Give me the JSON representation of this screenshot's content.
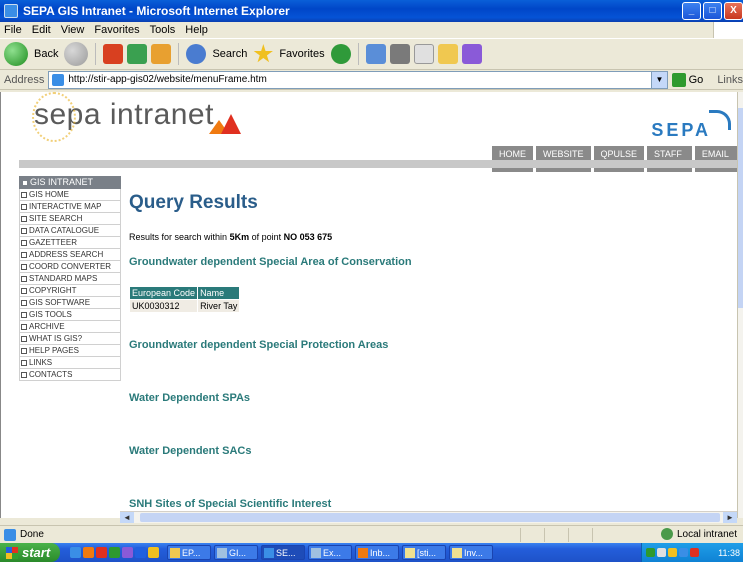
{
  "window": {
    "title": "SEPA GIS Intranet - Microsoft Internet Explorer",
    "controls": [
      "_",
      "□",
      "X"
    ]
  },
  "menubar": [
    "File",
    "Edit",
    "View",
    "Favorites",
    "Tools",
    "Help"
  ],
  "toolbar": {
    "back_label": "Back",
    "search_label": "Search",
    "favorites_label": "Favorites"
  },
  "address": {
    "label": "Address",
    "url": "http://stir-app-gis02/website/menuFrame.htm",
    "go_label": "Go",
    "links_label": "Links"
  },
  "site": {
    "logo_text": "sepa intranet",
    "brand": "SEPA",
    "top_nav": [
      "HOME",
      "WEBSITE",
      "QPULSE",
      "STAFF DIR",
      "EMAIL US"
    ]
  },
  "sidemenu": {
    "header": "GIS INTRANET",
    "items": [
      "GIS HOME",
      "INTERACTIVE MAP",
      "SITE SEARCH",
      "DATA CATALOGUE",
      "GAZETTEER",
      "ADDRESS SEARCH",
      "COORD CONVERTER",
      "STANDARD MAPS",
      "COPYRIGHT",
      "GIS SOFTWARE",
      "GIS TOOLS",
      "ARCHIVE",
      "WHAT IS GIS?",
      "HELP PAGES",
      "LINKS",
      "CONTACTS"
    ]
  },
  "main": {
    "title": "Query Results",
    "results_prefix": "Results for search within",
    "radius": "5Km",
    "of_point": "of point",
    "point": "NO 053 675",
    "sections": [
      "Groundwater dependent Special Area of Conservation",
      "Groundwater dependent Special Protection Areas",
      "Water Dependent SPAs",
      "Water Dependent SACs",
      "SNH Sites of Special Scientific Interest"
    ],
    "table": {
      "headers": [
        "European Code",
        "Name"
      ],
      "rows": [
        [
          "UK0030312",
          "River Tay"
        ]
      ]
    }
  },
  "status": {
    "text": "Done",
    "zone": "Local intranet"
  },
  "taskbar": {
    "start_label": "start",
    "tasks": [
      "EP...",
      "GI...",
      "SE...",
      "Ex...",
      "Inb...",
      "[sti...",
      "Inv..."
    ],
    "clock": "11:38"
  }
}
